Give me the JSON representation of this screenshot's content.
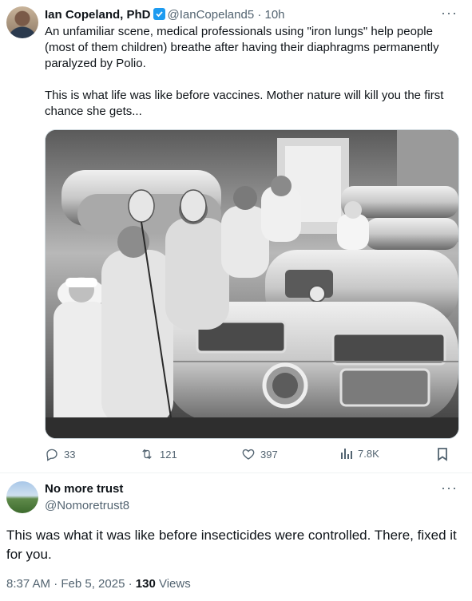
{
  "tweet": {
    "author_name": "Ian Copeland, PhD",
    "author_handle": "@IanCopeland5",
    "separator": "·",
    "time": "10h",
    "more": "···",
    "text_p1": "An unfamiliar scene, medical professionals using \"iron lungs\" help people (most of them children) breathe after having their diaphragms permanently paralyzed by Polio.",
    "text_p2": "This is what life was like before vaccines. Mother nature will kill you the first chance she gets...",
    "media_icon": "photo",
    "actions": {
      "replies": "33",
      "reposts": "121",
      "likes": "397",
      "views": "7.8K"
    }
  },
  "reply": {
    "author_name": "No more trust",
    "author_handle": "@Nomoretrust8",
    "more": "···",
    "text": "This was what it was like before insecticides were controlled. There, fixed it for you.",
    "time": "8:37 AM · Feb 5, 2025 · ",
    "views_count": "130",
    "views_label": " Views"
  },
  "colors": {
    "accent": "#1d9bf0",
    "muted": "#536471",
    "text": "#0f1419"
  }
}
